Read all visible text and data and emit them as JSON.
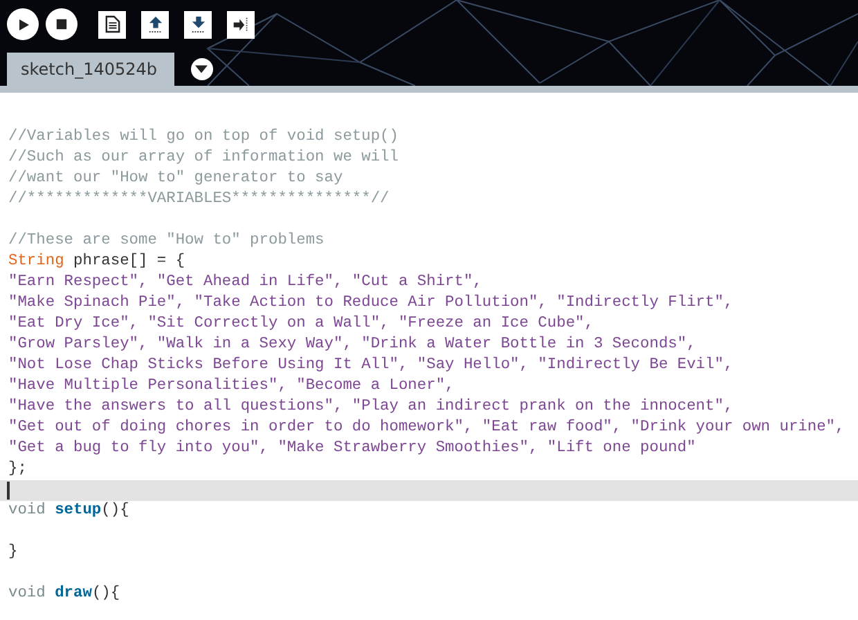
{
  "toolbar": {
    "buttons": [
      {
        "kind": "run"
      },
      {
        "kind": "stop"
      },
      {
        "kind": "new"
      },
      {
        "kind": "open"
      },
      {
        "kind": "save"
      },
      {
        "kind": "export"
      }
    ]
  },
  "tabs": [
    {
      "label": "sketch_140524b",
      "selected": true
    }
  ],
  "editor": {
    "lines": [
      {
        "current": false,
        "tokens": [
          {
            "kind": "comment",
            "text": "//Variables will go on top of void setup()"
          }
        ]
      },
      {
        "current": false,
        "tokens": [
          {
            "kind": "comment",
            "text": "//Such as our array of information we will"
          }
        ]
      },
      {
        "current": false,
        "tokens": [
          {
            "kind": "comment",
            "text": "//want our \"How to\" generator to say"
          }
        ]
      },
      {
        "current": false,
        "tokens": [
          {
            "kind": "comment",
            "text": "//*************VARIABLES***************//"
          }
        ]
      },
      {
        "current": false
      },
      {
        "current": false,
        "tokens": [
          {
            "kind": "comment",
            "text": "//These are some \"How to\" problems"
          }
        ]
      },
      {
        "current": false,
        "tokens": [
          {
            "kind": "type",
            "text": "String"
          },
          {
            "kind": "plain",
            "text": " phrase[] = {"
          }
        ]
      },
      {
        "current": false,
        "tokens": [
          {
            "kind": "string",
            "text": "\"Earn Respect\", \"Get Ahead in Life\", \"Cut a Shirt\","
          }
        ]
      },
      {
        "current": false,
        "tokens": [
          {
            "kind": "string",
            "text": "\"Make Spinach Pie\", \"Take Action to Reduce Air Pollution\", \"Indirectly Flirt\","
          }
        ]
      },
      {
        "current": false,
        "tokens": [
          {
            "kind": "string",
            "text": "\"Eat Dry Ice\", \"Sit Correctly on a Wall\", \"Freeze an Ice Cube\","
          }
        ]
      },
      {
        "current": false,
        "tokens": [
          {
            "kind": "string",
            "text": "\"Grow Parsley\", \"Walk in a Sexy Way\", \"Drink a Water Bottle in 3 Seconds\","
          }
        ]
      },
      {
        "current": false,
        "tokens": [
          {
            "kind": "string",
            "text": "\"Not Lose Chap Sticks Before Using It All\", \"Say Hello\", \"Indirectly Be Evil\","
          }
        ]
      },
      {
        "current": false,
        "tokens": [
          {
            "kind": "string",
            "text": "\"Have Multiple Personalities\", \"Become a Loner\","
          }
        ]
      },
      {
        "current": false,
        "tokens": [
          {
            "kind": "string",
            "text": "\"Have the answers to all questions\", \"Play an indirect prank on the innocent\","
          }
        ]
      },
      {
        "current": false,
        "tokens": [
          {
            "kind": "string",
            "text": "\"Get out of doing chores in order to do homework\", \"Eat raw food\", \"Drink your own urine\","
          }
        ]
      },
      {
        "current": false,
        "tokens": [
          {
            "kind": "string",
            "text": "\"Get a bug to fly into you\", \"Make Strawberry Smoothies\", \"Lift one pound\""
          }
        ]
      },
      {
        "current": false,
        "tokens": [
          {
            "kind": "plain",
            "text": "};"
          }
        ]
      },
      {
        "current": true
      },
      {
        "current": false,
        "tokens": [
          {
            "kind": "keyword",
            "text": "void "
          },
          {
            "kind": "function",
            "text": "setup"
          },
          {
            "kind": "plain",
            "text": "(){"
          }
        ]
      },
      {
        "current": false
      },
      {
        "current": false,
        "tokens": [
          {
            "kind": "plain",
            "text": "}"
          }
        ]
      },
      {
        "current": false
      },
      {
        "current": false,
        "tokens": [
          {
            "kind": "keyword",
            "text": "void "
          },
          {
            "kind": "function",
            "text": "draw"
          },
          {
            "kind": "plain",
            "text": "(){"
          }
        ]
      }
    ]
  }
}
